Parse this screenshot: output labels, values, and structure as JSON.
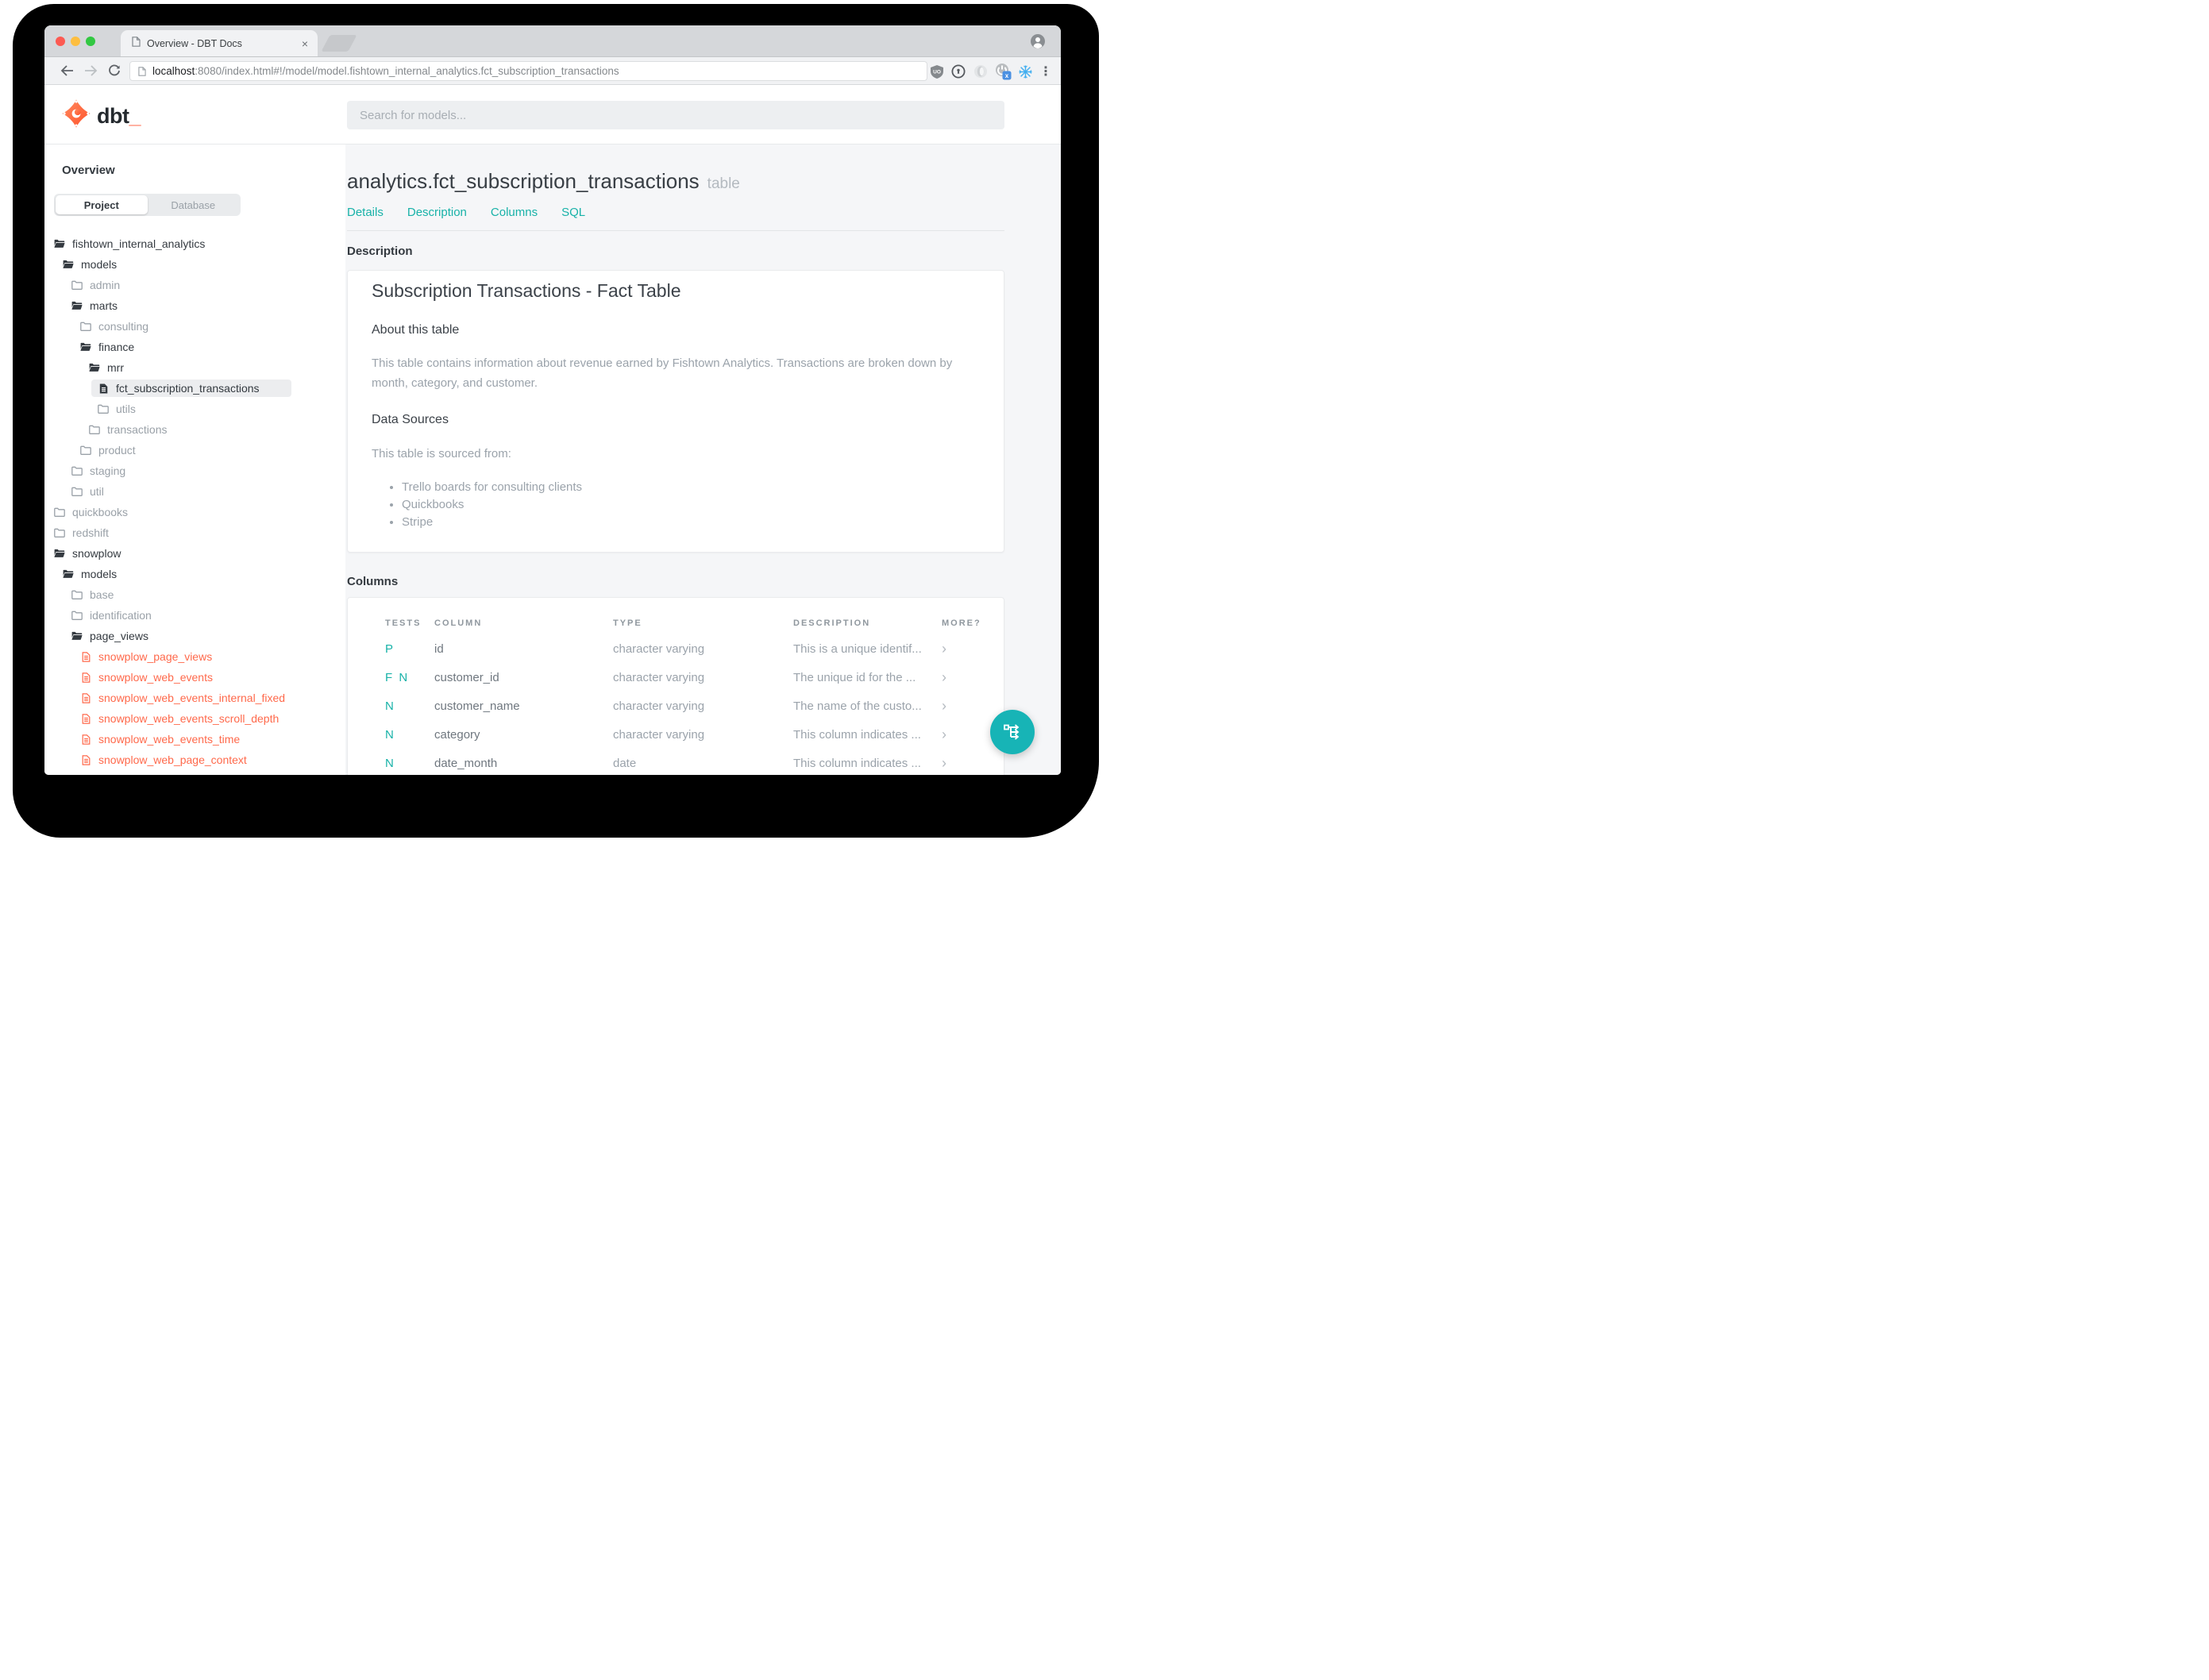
{
  "colors": {
    "accent_teal": "#18b2a8",
    "fab_teal": "#17b4b6",
    "brand_orange": "#ff694b",
    "tab_strip_grey": "#d5d7da",
    "main_bg": "#f5f6f8"
  },
  "browser": {
    "tab_title": "Overview - DBT Docs",
    "tab_close": "×",
    "url_host": "localhost",
    "url_rest": ":8080/index.html#!/model/model.fishtown_internal_analytics.fct_subscription_transactions",
    "menu_dots": "⋮"
  },
  "header": {
    "logo_text": "dbt",
    "logo_underscore": "_",
    "search_placeholder": "Search for models..."
  },
  "sidebar": {
    "heading": "Overview",
    "tabs": {
      "project": "Project",
      "database": "Database"
    },
    "tree": [
      {
        "label": "fishtown_internal_analytics",
        "level": 0,
        "icon": "folder-open",
        "state": "active"
      },
      {
        "label": "models",
        "level": 1,
        "icon": "folder-open",
        "state": "active"
      },
      {
        "label": "admin",
        "level": 2,
        "icon": "folder",
        "state": "muted"
      },
      {
        "label": "marts",
        "level": 2,
        "icon": "folder-open",
        "state": "active"
      },
      {
        "label": "consulting",
        "level": 3,
        "icon": "folder",
        "state": "muted"
      },
      {
        "label": "finance",
        "level": 3,
        "icon": "folder-open",
        "state": "active"
      },
      {
        "label": "mrr",
        "level": 4,
        "icon": "folder-open",
        "state": "active"
      },
      {
        "label": "fct_subscription_transactions",
        "level": 5,
        "icon": "file-filled",
        "state": "selected"
      },
      {
        "label": "utils",
        "level": 5,
        "icon": "folder",
        "state": "muted"
      },
      {
        "label": "transactions",
        "level": 4,
        "icon": "folder",
        "state": "muted"
      },
      {
        "label": "product",
        "level": 3,
        "icon": "folder",
        "state": "muted"
      },
      {
        "label": "staging",
        "level": 2,
        "icon": "folder",
        "state": "muted"
      },
      {
        "label": "util",
        "level": 2,
        "icon": "folder",
        "state": "muted"
      },
      {
        "label": "quickbooks",
        "level": 0,
        "icon": "folder",
        "state": "muted"
      },
      {
        "label": "redshift",
        "level": 0,
        "icon": "folder",
        "state": "muted"
      },
      {
        "label": "snowplow",
        "level": 0,
        "icon": "folder-open",
        "state": "active"
      },
      {
        "label": "models",
        "level": 1,
        "icon": "folder-open",
        "state": "active"
      },
      {
        "label": "base",
        "level": 2,
        "icon": "folder",
        "state": "muted"
      },
      {
        "label": "identification",
        "level": 2,
        "icon": "folder",
        "state": "muted"
      },
      {
        "label": "page_views",
        "level": 2,
        "icon": "folder-open",
        "state": "active"
      },
      {
        "label": "snowplow_page_views",
        "level": 3,
        "icon": "file-outline",
        "state": "error"
      },
      {
        "label": "snowplow_web_events",
        "level": 3,
        "icon": "file-outline",
        "state": "error"
      },
      {
        "label": "snowplow_web_events_internal_fixed",
        "level": 3,
        "icon": "file-outline",
        "state": "error"
      },
      {
        "label": "snowplow_web_events_scroll_depth",
        "level": 3,
        "icon": "file-outline",
        "state": "error"
      },
      {
        "label": "snowplow_web_events_time",
        "level": 3,
        "icon": "file-outline",
        "state": "error"
      },
      {
        "label": "snowplow_web_page_context",
        "level": 3,
        "icon": "file-outline",
        "state": "error"
      }
    ]
  },
  "main": {
    "title": "analytics.fct_subscription_transactions",
    "title_suffix": "table",
    "nav": [
      "Details",
      "Description",
      "Columns",
      "SQL"
    ],
    "description": {
      "section_heading": "Description",
      "doc_title": "Subscription Transactions - Fact Table",
      "about_heading": "About this table",
      "about_text": "This table contains information about revenue earned by Fishtown Analytics. Transactions are broken down by month, category, and customer.",
      "sources_heading": "Data Sources",
      "sources_intro": "This table is sourced from:",
      "sources": [
        "Trello boards for consulting clients",
        "Quickbooks",
        "Stripe"
      ]
    },
    "columns": {
      "section_heading": "Columns",
      "headers": {
        "tests": "TESTS",
        "column": "COLUMN",
        "type": "TYPE",
        "description": "DESCRIPTION",
        "more": "MORE?"
      },
      "rows": [
        {
          "tests": "P",
          "column": "id",
          "type": "character varying",
          "description": "This is a unique identif...",
          "more": "›"
        },
        {
          "tests": "F N",
          "column": "customer_id",
          "type": "character varying",
          "description": "The unique id for the ...",
          "more": "›"
        },
        {
          "tests": "N",
          "column": "customer_name",
          "type": "character varying",
          "description": "The name of the custo...",
          "more": "›"
        },
        {
          "tests": "N",
          "column": "category",
          "type": "character varying",
          "description": "This column indicates ...",
          "more": "›"
        },
        {
          "tests": "N",
          "column": "date_month",
          "type": "date",
          "description": "This column indicates ...",
          "more": "›"
        }
      ]
    }
  }
}
